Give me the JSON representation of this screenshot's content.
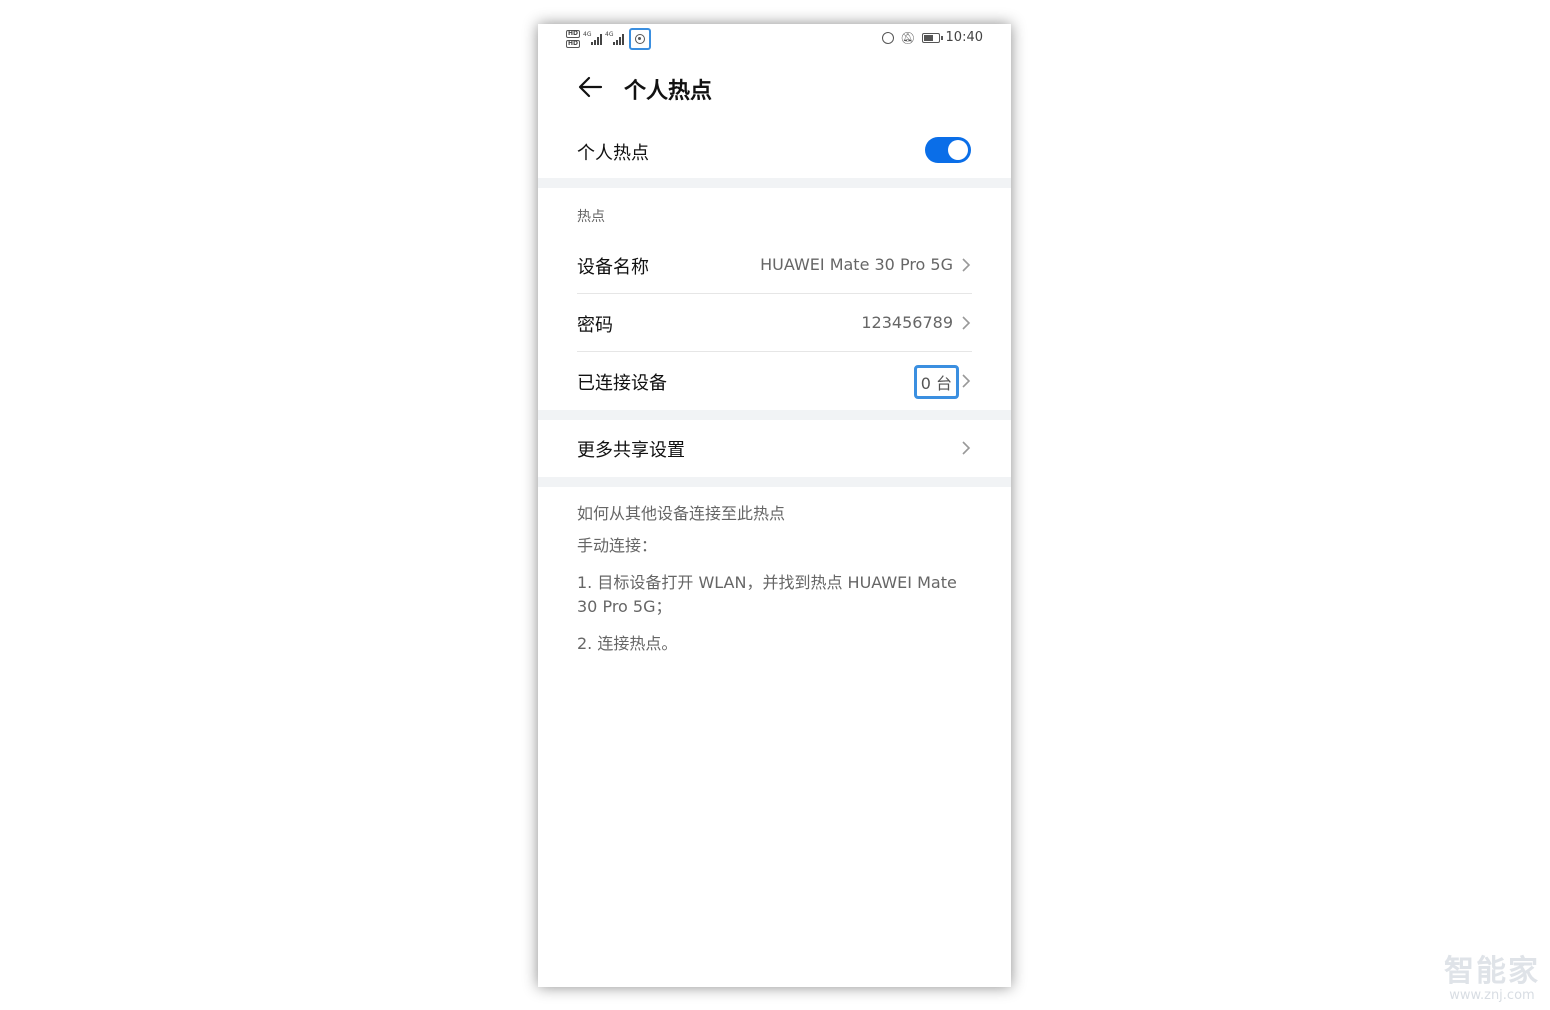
{
  "status_bar": {
    "hd_badge": "HD",
    "network_label": "4G",
    "network_label_2": "4G",
    "time": "10:40",
    "icons": [
      "hd-icon",
      "signal-icon",
      "hotspot-status-icon",
      "alarm-icon",
      "mute-icon",
      "battery-icon"
    ]
  },
  "header": {
    "title": "个人热点"
  },
  "hotspot_toggle": {
    "label": "个人热点",
    "enabled": true,
    "accent": "#0a6ee8"
  },
  "hotspot_section": {
    "heading": "热点",
    "device_name": {
      "label": "设备名称",
      "value": "HUAWEI Mate 30 Pro 5G"
    },
    "password": {
      "label": "密码",
      "value": "123456789"
    },
    "connected": {
      "label": "已连接设备",
      "value": "0 台"
    }
  },
  "more_settings": {
    "label": "更多共享设置"
  },
  "instructions": {
    "title": "如何从其他设备连接至此热点",
    "manual": "手动连接：",
    "step1": "1. 目标设备打开 WLAN，并找到热点 HUAWEI Mate 30 Pro 5G；",
    "step2": "2. 连接热点。"
  },
  "watermark": {
    "brand": "智能家",
    "url": "www.znj.com"
  },
  "colors": {
    "highlight": "#3b8fe0",
    "band": "#f1f3f5"
  }
}
